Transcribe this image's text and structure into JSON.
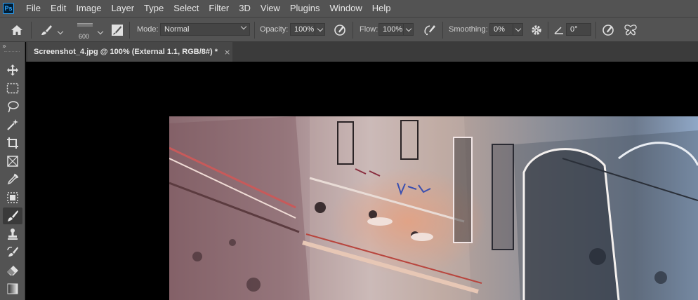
{
  "app": {
    "logo_text": "Ps"
  },
  "menu": [
    "File",
    "Edit",
    "Image",
    "Layer",
    "Type",
    "Select",
    "Filter",
    "3D",
    "View",
    "Plugins",
    "Window",
    "Help"
  ],
  "options": {
    "brush_size": "600",
    "mode_label": "Mode:",
    "mode_value": "Normal",
    "opacity_label": "Opacity:",
    "opacity_value": "100%",
    "flow_label": "Flow:",
    "flow_value": "100%",
    "smoothing_label": "Smoothing:",
    "smoothing_value": "0%",
    "angle_value": "0°"
  },
  "document": {
    "tab_title": "Screenshot_4.jpg @ 100% (External 1.1, RGB/8#) *",
    "close_glyph": "×"
  },
  "tools": [
    "move-tool-icon",
    "rectangular-marquee-icon",
    "lasso-icon",
    "magic-wand-icon",
    "crop-icon",
    "frame-icon",
    "eyedropper-icon",
    "healing-brush-icon",
    "brush-icon",
    "clone-stamp-icon",
    "history-brush-icon",
    "eraser-icon",
    "gradient-icon"
  ],
  "active_tool": "brush-icon",
  "colors": {
    "chrome": "#535353",
    "tab_bar": "#3b3b3b",
    "canvas": "#000000",
    "accent": "#31a8ff"
  }
}
